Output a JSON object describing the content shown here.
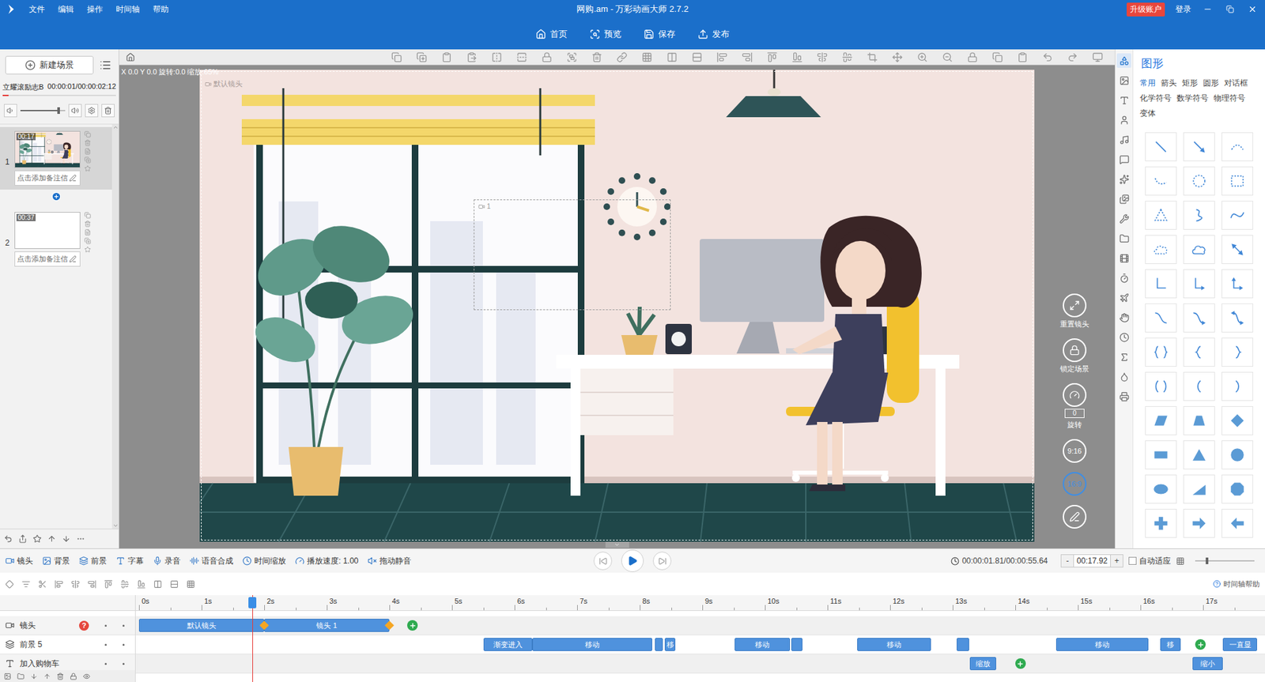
{
  "window": {
    "title": "网购.am - 万彩动画大师 2.7.2"
  },
  "menu": [
    "文件",
    "编辑",
    "操作",
    "时间轴",
    "帮助"
  ],
  "account": {
    "upgrade": "升级账户",
    "login": "登录"
  },
  "actions": [
    "首页",
    "预览",
    "保存",
    "发布"
  ],
  "scene_panel": {
    "new_scene": "新建场景",
    "music": {
      "name": "立耀滚励志B",
      "time": "00:00:01/00:00:02:12",
      "level": 0.05
    },
    "volume": {
      "level": 0.85
    },
    "scenes": [
      {
        "index": "1",
        "duration": "00:17",
        "note": "点击添加备注信",
        "kind": "scene",
        "selected": true
      },
      {
        "index": "2",
        "duration": "00:37",
        "note": "点击添加备注信",
        "kind": "blank",
        "selected": false
      }
    ]
  },
  "canvas": {
    "coords": "X 0.0 Y 0.0 旋转:0.0 缩放:65%",
    "camera_label": "默认镜头",
    "frame_label": "1"
  },
  "view_controls": [
    {
      "label": "重置镜头",
      "kind": "reset",
      "value": ""
    },
    {
      "label": "锁定场景",
      "kind": "lock",
      "value": ""
    },
    {
      "label": "旋转",
      "kind": "rotate",
      "value": "0"
    }
  ],
  "ratios": [
    {
      "label": "9:16",
      "selected": false
    },
    {
      "label": "16:9",
      "selected": true
    }
  ],
  "shape_panel": {
    "title": "图形",
    "tabs": [
      {
        "label": "常用",
        "selected": true
      },
      {
        "label": "箭头",
        "selected": false
      },
      {
        "label": "矩形",
        "selected": false
      },
      {
        "label": "圆形",
        "selected": false
      },
      {
        "label": "对话框",
        "selected": false
      },
      {
        "label": "化学符号",
        "selected": false
      },
      {
        "label": "数学符号",
        "selected": false
      },
      {
        "label": "物理符号",
        "selected": false
      },
      {
        "label": "变体",
        "selected": false
      }
    ]
  },
  "timeline": {
    "tools": [
      {
        "label": "镜头",
        "kind": "camera"
      },
      {
        "label": "背景",
        "kind": "background"
      },
      {
        "label": "前景",
        "kind": "foreground"
      },
      {
        "label": "字幕",
        "kind": "caption"
      },
      {
        "label": "录音",
        "kind": "record"
      },
      {
        "label": "语音合成",
        "kind": "tts"
      },
      {
        "label": "时间缩放",
        "kind": "scale"
      },
      {
        "label": "播放速度: 1.00",
        "kind": "speed"
      },
      {
        "label": "拖动静音",
        "kind": "mute"
      }
    ],
    "time": "00:00:01.81/00:00:55.64",
    "zoom": {
      "minus": "-",
      "value": "00:17.92",
      "plus": "+"
    },
    "auto_fit": {
      "label": "自动适应",
      "checked": false
    },
    "zoom_slider": {
      "level": 0.2
    },
    "help": "时间轴帮助",
    "ruler": [
      "0s",
      "1s",
      "2s",
      "3s",
      "4s",
      "5s",
      "6s",
      "7s",
      "8s",
      "9s",
      "10s",
      "11s",
      "12s",
      "13s",
      "14s",
      "15s",
      "16s",
      "17s"
    ],
    "playhead": 1.81,
    "tracks": [
      {
        "name": "镜头",
        "kind": "camera",
        "badge": "?",
        "clips": [
          {
            "kind": "clip",
            "label": "默认镜头",
            "start": 0,
            "end": 2.0
          },
          {
            "kind": "clip",
            "label": "镜头 1",
            "start": 2.0,
            "end": 4.0
          },
          {
            "kind": "key",
            "label": "",
            "start": 2.0,
            "end": 2.0
          },
          {
            "kind": "key",
            "label": "",
            "start": 4.0,
            "end": 4.0
          },
          {
            "kind": "add",
            "label": "",
            "start": 4.37,
            "end": 4.37
          }
        ]
      },
      {
        "name": "前景 5",
        "kind": "foreground",
        "badge": "",
        "clips": [
          {
            "kind": "clip",
            "label": "渐变进入",
            "start": 5.5,
            "end": 6.28
          },
          {
            "kind": "clip",
            "label": "移动",
            "start": 6.28,
            "end": 8.2
          },
          {
            "kind": "clip",
            "label": "",
            "start": 8.24,
            "end": 8.37
          },
          {
            "kind": "clip",
            "label": "移",
            "start": 8.4,
            "end": 8.57
          },
          {
            "kind": "clip",
            "label": "移动",
            "start": 9.52,
            "end": 10.4
          },
          {
            "kind": "clip",
            "label": "",
            "start": 10.42,
            "end": 10.6
          },
          {
            "kind": "clip",
            "label": "移动",
            "start": 11.47,
            "end": 12.65
          },
          {
            "kind": "clip",
            "label": "",
            "start": 13.06,
            "end": 13.26
          },
          {
            "kind": "clip",
            "label": "移动",
            "start": 14.65,
            "end": 16.13
          },
          {
            "kind": "clip",
            "label": "移",
            "start": 16.32,
            "end": 16.64
          },
          {
            "kind": "add",
            "label": "",
            "start": 16.96,
            "end": 16.96
          },
          {
            "kind": "clip",
            "label": "一直显",
            "start": 17.32,
            "end": 17.86
          }
        ]
      },
      {
        "name": "加入购物车",
        "kind": "text",
        "badge": "",
        "clips": [
          {
            "kind": "clip",
            "label": "缩放",
            "start": 13.27,
            "end": 13.7
          },
          {
            "kind": "add",
            "label": "",
            "start": 14.08,
            "end": 14.08
          },
          {
            "kind": "clip",
            "label": "缩小",
            "start": 16.83,
            "end": 17.32
          }
        ]
      }
    ]
  }
}
